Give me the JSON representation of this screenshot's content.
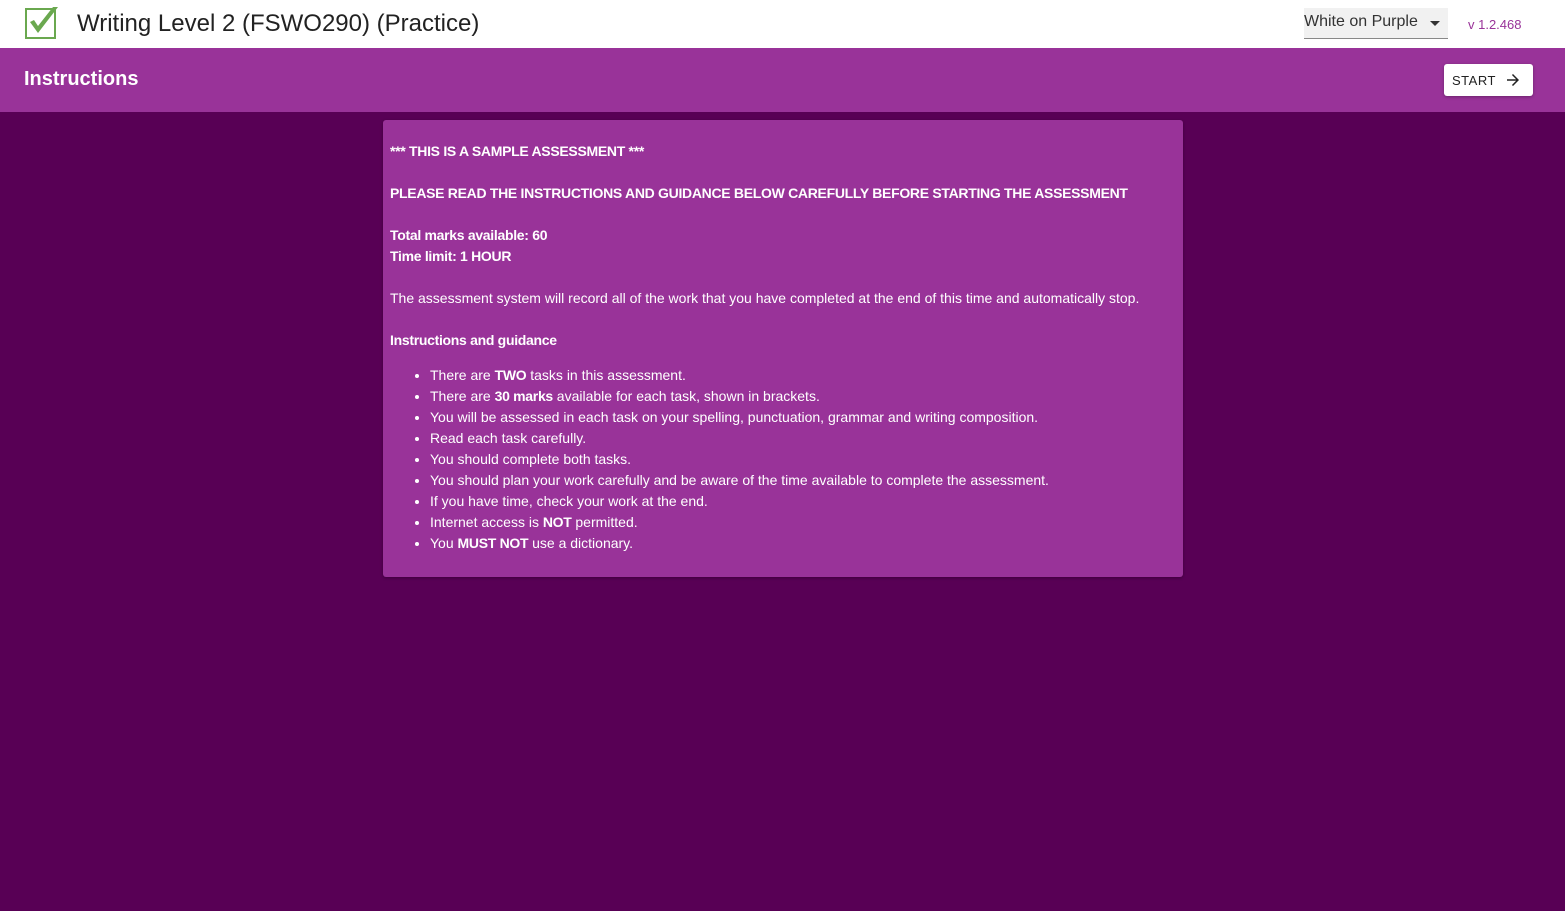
{
  "app": {
    "title": "Writing Level 2 (FSWO290) (Practice)",
    "logo_icon": "check-box-icon",
    "version": "v 1.2.468"
  },
  "theme_select": {
    "value": "White on Purple",
    "icon": "chevron-down-icon"
  },
  "toolbar": {
    "title": "Instructions",
    "start_label": "START",
    "start_icon": "arrow-right-icon"
  },
  "colors": {
    "background": "#580055",
    "accent": "#993399",
    "logo_green": "#6aa84f"
  },
  "instructions": {
    "sample_notice": "*** THIS IS A SAMPLE ASSESSMENT ***",
    "read_notice": "PLEASE READ THE INSTRUCTIONS AND GUIDANCE BELOW CAREFULLY BEFORE STARTING THE ASSESSMENT",
    "total_marks": "Total marks available: 60",
    "time_limit": "Time limit: 1 HOUR",
    "system_note": "The assessment system will record all of the work that you have completed at the end of this time and automatically stop.",
    "guidance_heading": "Instructions and guidance",
    "items": [
      {
        "before": "There are ",
        "bold": "TWO",
        "after": " tasks in this assessment."
      },
      {
        "before": "There are ",
        "bold": "30 marks",
        "after": " available for each task, shown in brackets."
      },
      {
        "before": "You will be assessed in each task on your spelling, punctuation, grammar and writing composition.",
        "bold": "",
        "after": ""
      },
      {
        "before": "Read each task carefully.",
        "bold": "",
        "after": ""
      },
      {
        "before": "You should complete both tasks.",
        "bold": "",
        "after": ""
      },
      {
        "before": "You should plan your work carefully and be aware of the time available to complete the assessment.",
        "bold": "",
        "after": ""
      },
      {
        "before": "If you have time, check your work at the end.",
        "bold": "",
        "after": ""
      },
      {
        "before": "Internet access is ",
        "bold": "NOT",
        "after": " permitted."
      },
      {
        "before": "You ",
        "bold": "MUST NOT",
        "after": " use a dictionary."
      }
    ]
  }
}
